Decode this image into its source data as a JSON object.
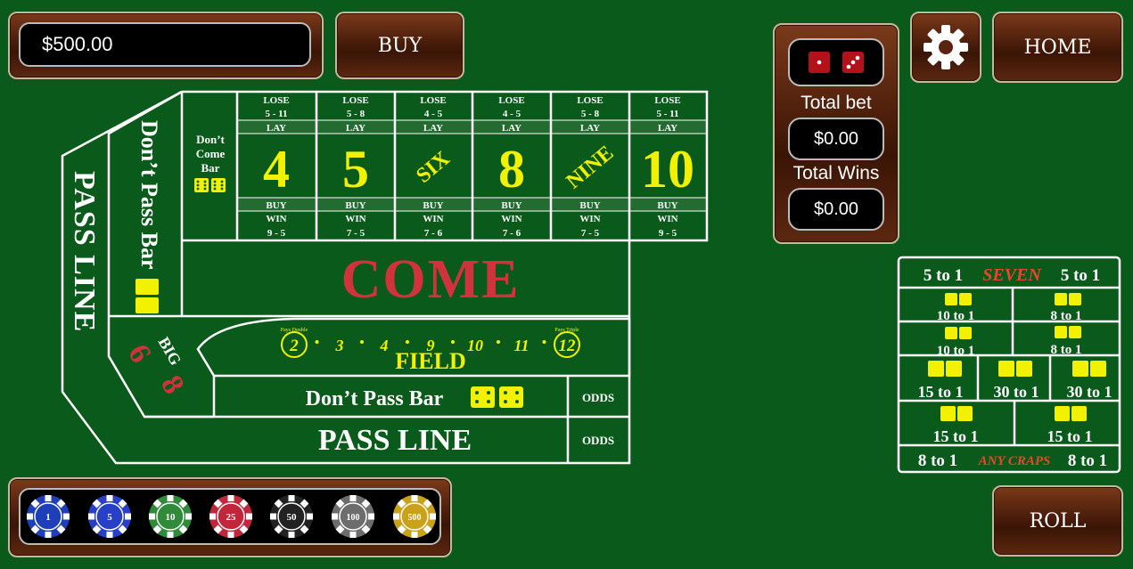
{
  "balance": "$500.00",
  "buttons": {
    "buy": "BUY",
    "home": "HOME",
    "roll": "ROLL"
  },
  "stats": {
    "total_bet_label": "Total bet",
    "total_bet": "$0.00",
    "total_wins_label": "Total Wins",
    "total_wins": "$0.00"
  },
  "table": {
    "pass_line": "PASS LINE",
    "dont_pass_bar_vertical": "Don’t Pass Bar",
    "dont_pass_bar": "Don’t Pass Bar",
    "dont_come_bar": [
      "Don’t",
      "Come",
      "Bar"
    ],
    "come": "COME",
    "field": "FIELD",
    "field_numbers": [
      "2",
      "3",
      "4",
      "9",
      "10",
      "11",
      "12"
    ],
    "field_pays_double": "Pays Double",
    "field_pays_triple": "Pays Triple",
    "big": "BIG",
    "big_numbers": [
      "6",
      "8"
    ],
    "odds": "ODDS",
    "place_numbers": [
      {
        "label": "4",
        "lose": "5 - 11",
        "win": "9 - 5"
      },
      {
        "label": "5",
        "lose": "5 - 8",
        "win": "7 - 5"
      },
      {
        "label": "SIX",
        "lose": "4 - 5",
        "win": "7 - 6"
      },
      {
        "label": "8",
        "lose": "4 - 5",
        "win": "7 - 6"
      },
      {
        "label": "NINE",
        "lose": "5 - 8",
        "win": "7 - 5"
      },
      {
        "label": "10",
        "lose": "5 - 11",
        "win": "9 - 5"
      }
    ],
    "lose": "LOSE",
    "lay": "LAY",
    "buy": "BUY",
    "win": "WIN"
  },
  "props": {
    "seven_left": "5 to 1",
    "seven": "SEVEN",
    "seven_right": "5 to 1",
    "hardways": [
      "10 to 1",
      "8 to 1",
      "10 to 1",
      "8 to 1"
    ],
    "row3": [
      "15 to 1",
      "30 to 1",
      "30 to 1"
    ],
    "row4": [
      "15 to 1",
      "15 to 1"
    ],
    "craps_left": "8 to 1",
    "craps": "ANY CRAPS",
    "craps_right": "8 to 1"
  },
  "chips": [
    {
      "value": "1",
      "color": "#1f3fb8"
    },
    {
      "value": "5",
      "color": "#2840c8"
    },
    {
      "value": "10",
      "color": "#2f8a3a"
    },
    {
      "value": "25",
      "color": "#c2263a"
    },
    {
      "value": "50",
      "color": "#222222"
    },
    {
      "value": "100",
      "color": "#6d6d6d"
    },
    {
      "value": "500",
      "color": "#c9a21a"
    }
  ],
  "colors": {
    "felt": "#0a5b1b",
    "yellow": "#f2f200",
    "red": "#d0333c",
    "line": "#ffffff"
  }
}
